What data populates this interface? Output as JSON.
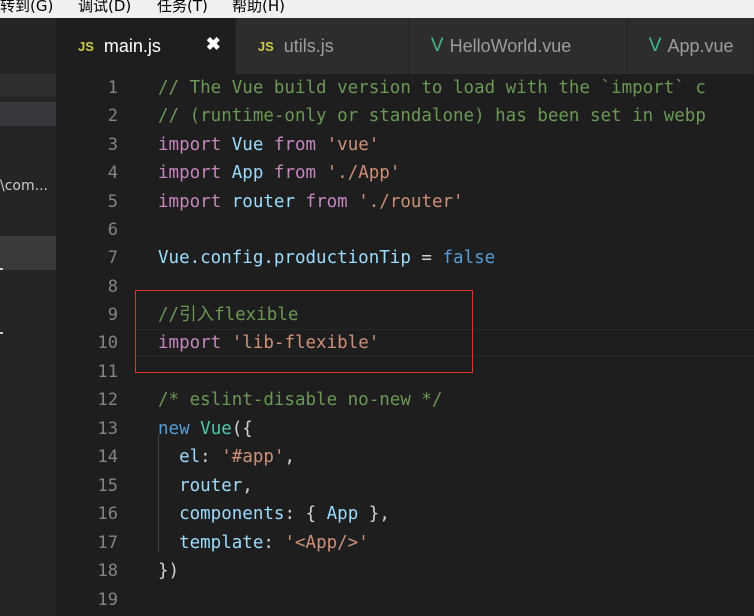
{
  "menu": {
    "items": [
      "转到(G)",
      "调试(D)",
      "任务(T)",
      "帮助(H)"
    ]
  },
  "sidebar": {
    "partial_text": "\\com..."
  },
  "tabs": [
    {
      "label": "main.js",
      "icon": "js-icon",
      "active": true,
      "close": "✖"
    },
    {
      "label": "utils.js",
      "icon": "js-icon",
      "active": false
    },
    {
      "label": "HelloWorld.vue",
      "icon": "vue-icon",
      "active": false
    },
    {
      "label": "App.vue",
      "icon": "vue-icon",
      "active": false
    }
  ],
  "icons": {
    "js": "JS",
    "vue": "V"
  },
  "colors": {
    "keyword": "#c586c0",
    "string": "#ce9178",
    "comment": "#6a9955",
    "identifier": "#9cdcfe",
    "highlight_box": "#e0362a"
  },
  "code": {
    "l1": "// The Vue build version to load with the `import` c",
    "l2": "// (runtime-only or standalone) has been set in webp",
    "l3_kw": "import",
    "l3_id": "Vue",
    "l3_from": "from",
    "l3_str": "'vue'",
    "l4_kw": "import",
    "l4_id": "App",
    "l4_from": "from",
    "l4_str": "'./App'",
    "l5_kw": "import",
    "l5_id": "router",
    "l5_from": "from",
    "l5_str": "'./router'",
    "l7_id": "Vue.config.productionTip",
    "l7_op": "=",
    "l7_val": "false",
    "l9": "//引入flexible",
    "l10_kw": "import",
    "l10_str": "'lib-flexible'",
    "l12": "/* eslint-disable no-new */",
    "l13_new": "new",
    "l13_cls": "Vue",
    "l13_rest": "({",
    "l14_key": "el",
    "l14_colon": ":",
    "l14_str": "'#app'",
    "l14_end": ",",
    "l15_id": "router",
    "l15_end": ",",
    "l16_key": "components",
    "l16_colon": ":",
    "l16_open": "{",
    "l16_id": "App",
    "l16_close": "},",
    "l17_key": "template",
    "l17_colon": ":",
    "l17_str": "'<App/>'",
    "l18": "})"
  },
  "line_numbers": [
    "1",
    "2",
    "3",
    "4",
    "5",
    "6",
    "7",
    "8",
    "9",
    "10",
    "11",
    "12",
    "13",
    "14",
    "15",
    "16",
    "17",
    "18",
    "19"
  ]
}
